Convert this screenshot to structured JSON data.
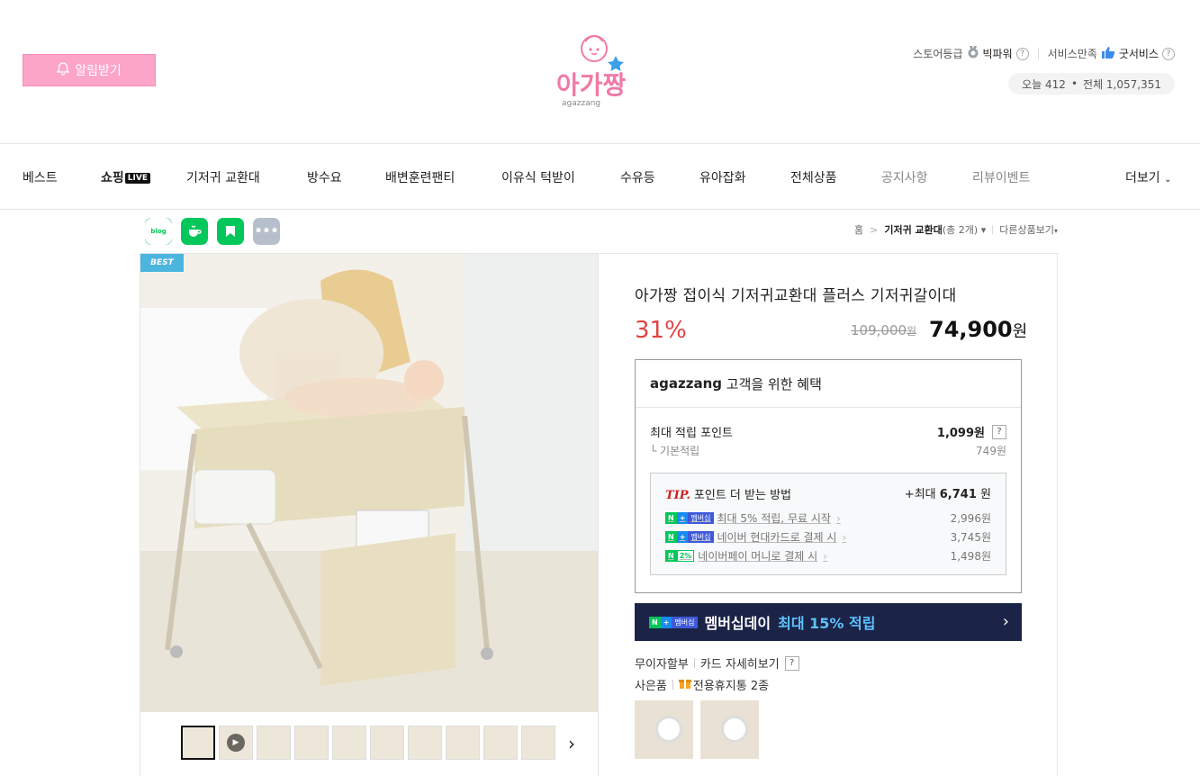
{
  "header": {
    "alarm_label": "알림받기",
    "logo_text": "아가짱",
    "logo_sub": "agazzang",
    "store_grade_label": "스토어등급",
    "store_grade_value": "빅파워",
    "service_label": "서비스만족",
    "service_value": "굿서비스",
    "today_label": "오늘 412",
    "total_label": "전체 1,057,351"
  },
  "nav": {
    "items": [
      "베스트",
      "쇼핑",
      "기저귀 교환대",
      "방수요",
      "배변훈련팬티",
      "이유식 턱받이",
      "수유등",
      "유아잡화",
      "전체상품",
      "공지사항",
      "리뷰이벤트",
      "더보기"
    ],
    "live_badge": "LIVE"
  },
  "social": {
    "blog": "blog"
  },
  "breadcrumb": {
    "home": "홈",
    "category": "기저귀 교환대",
    "count": "(총 2개)",
    "other": "다른상품보기"
  },
  "product": {
    "best_badge": "BEST",
    "title": "아가짱 접이식 기저귀교환대 플러스 기저귀갈이대",
    "discount": "31%",
    "original_price": "109,000",
    "price": "74,900",
    "won": "원"
  },
  "benefit": {
    "brand": "agazzang",
    "heading_rest": "고객을 위한 혜택",
    "max_point_label": "최대 적립 포인트",
    "max_point_value": "1,099원",
    "base_label": "기본적립",
    "base_value": "749원",
    "tip_label": "TIP.",
    "tip_title": "포인트 더 받는 방법",
    "tip_max_prefix": "+최대",
    "tip_max_value": "6,741",
    "tip_max_unit": "원",
    "tips": [
      {
        "badge": "멤버십",
        "label": "최대 5% 적립, 무료 시작",
        "value": "2,996원"
      },
      {
        "badge": "멤버십",
        "label": "네이버 현대카드로 결제 시",
        "value": "3,745원"
      },
      {
        "badge": "2%",
        "label": "네이버페이 머니로 결제 시",
        "value": "1,498원"
      }
    ]
  },
  "banner": {
    "badge": "멤버십",
    "text": "멤버십데이",
    "highlight": "최대 15% 적립"
  },
  "extras": {
    "installment": "무이자할부",
    "card_detail": "카드 자세히보기",
    "gift_label": "사은품",
    "gift_value": "전용휴지통 2종"
  },
  "colors": {
    "alarm_bg": "#fca5c9",
    "discount": "#e04343",
    "banner_bg": "#1b2447",
    "banner_highlight": "#5ec2ff",
    "naver_green": "#03c75a"
  }
}
